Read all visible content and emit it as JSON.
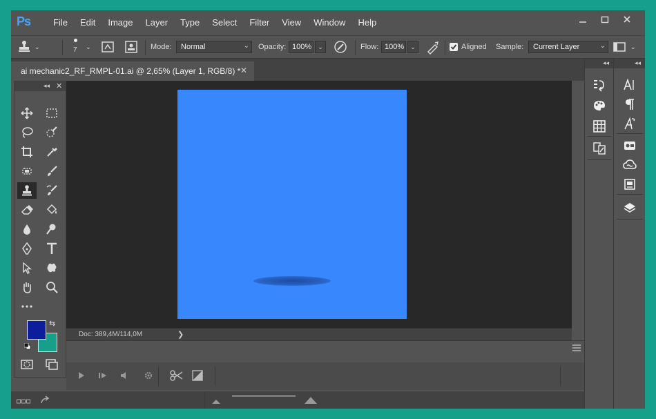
{
  "app": {
    "logo": "Ps"
  },
  "menu": [
    "File",
    "Edit",
    "Image",
    "Layer",
    "Type",
    "Select",
    "Filter",
    "View",
    "Window",
    "Help"
  ],
  "window_controls": [
    "minimize-icon",
    "restore-icon",
    "close-icon"
  ],
  "options_bar": {
    "brush_size": "7",
    "mode_label": "Mode:",
    "mode_value": "Normal",
    "opacity_label": "Opacity:",
    "opacity_value": "100%",
    "flow_label": "Flow:",
    "flow_value": "100%",
    "aligned_label": "Aligned",
    "aligned_checked": true,
    "sample_label": "Sample:",
    "sample_value": "Current Layer"
  },
  "document_tab": {
    "title": "ai mechanic2_RF_RMPL-01.ai @ 2,65% (Layer 1, RGB/8) *",
    "close": "✕"
  },
  "status": {
    "doc": "Doc: 389,4M/114,0M",
    "arrow": "❯"
  },
  "canvas": {
    "color": "#3987fd",
    "shadow_color": "#1d4aa0"
  },
  "swatches": {
    "foreground": "#0c1e9c",
    "background": "#16a08b"
  },
  "toolbox": {
    "collapse": "◂◂",
    "close": "✕"
  },
  "colors": {
    "frame": "#16a08b",
    "ui": "#535353",
    "workspace": "#282828"
  }
}
